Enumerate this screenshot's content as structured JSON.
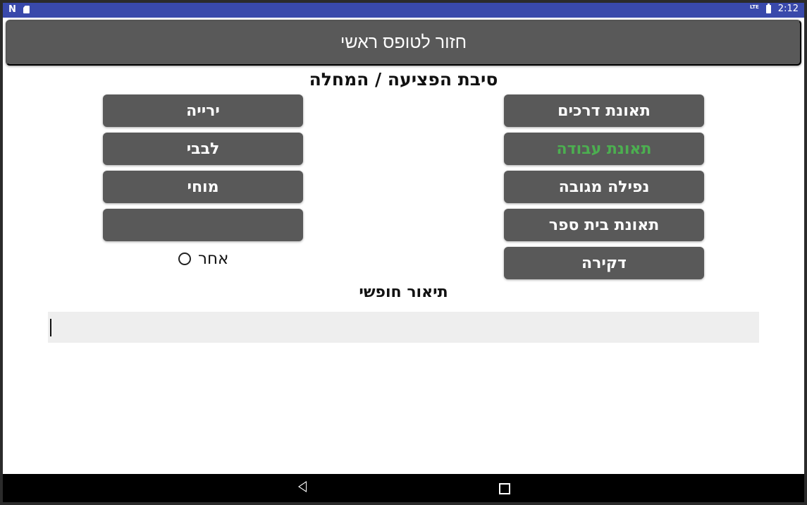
{
  "status_bar": {
    "left_icons": [
      "n-logo-icon",
      "sd-card-icon"
    ],
    "network": "LTE",
    "time": "2:12"
  },
  "header": {
    "button_label": "חזור לטופס ראשי"
  },
  "section": {
    "title": "סיבת הפציעה / המחלה"
  },
  "choices": {
    "right": [
      "תאונת דרכים",
      "תאונת עבודה",
      "נפילה מגובה",
      "תאונת בית ספר",
      "דקירה"
    ],
    "left": [
      "ירייה",
      "לבבי",
      "מוחי",
      ""
    ],
    "selected": "תאונת עבודה",
    "selected_color": "#4caf50"
  },
  "other": {
    "label": "אחר"
  },
  "free_text": {
    "title": "תיאור חופשי",
    "value": ""
  },
  "colors": {
    "status_bar": "#3949ab",
    "button": "#595959",
    "input_bg": "#eeeeee"
  }
}
